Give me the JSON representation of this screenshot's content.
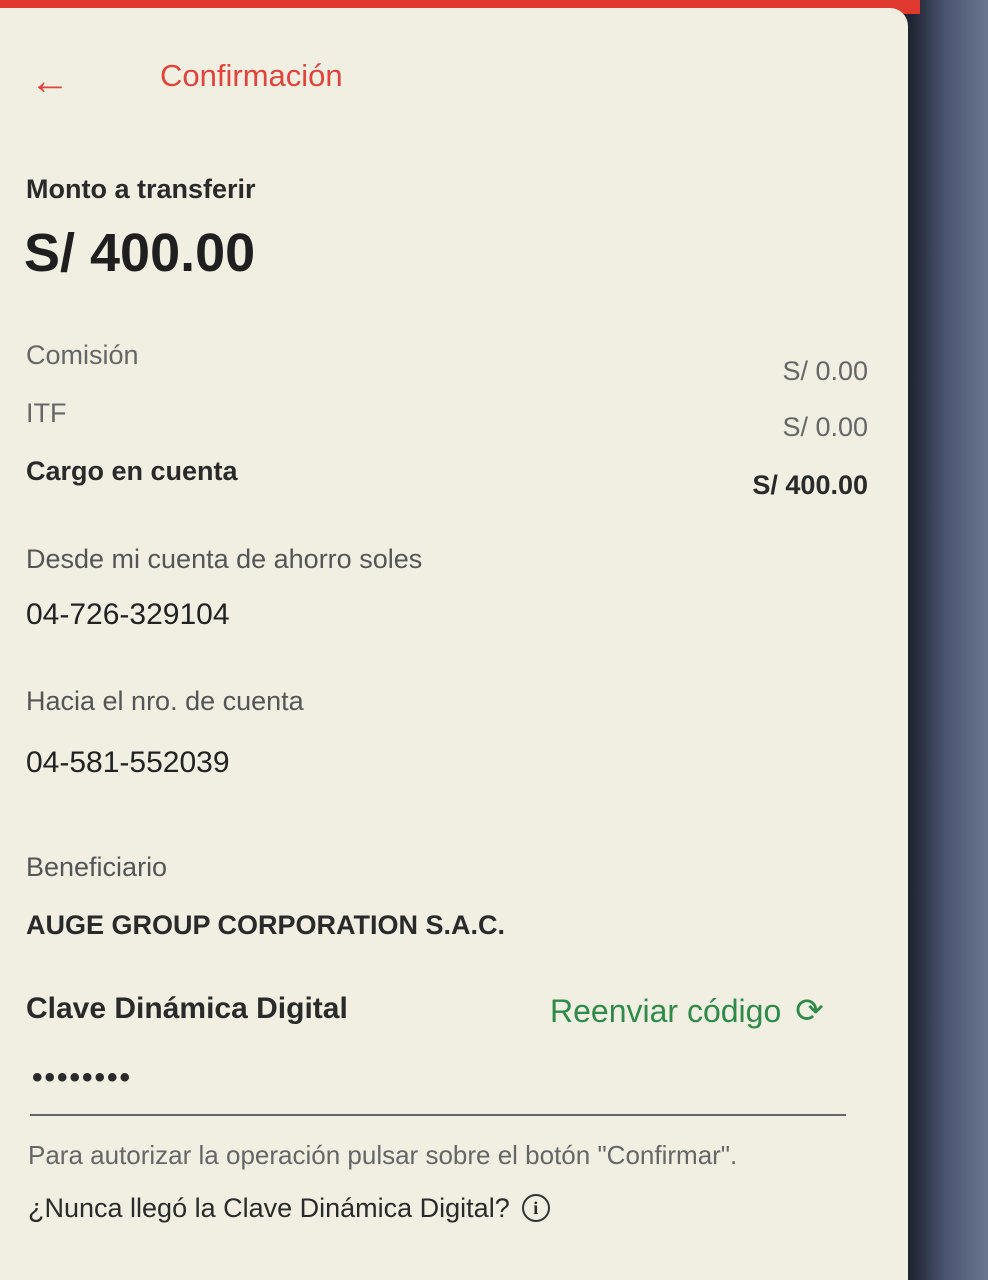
{
  "header": {
    "title": "Confirmación"
  },
  "transfer": {
    "label": "Monto a transferir",
    "amount": "S/ 400.00"
  },
  "charges": {
    "commission_label": "Comisión",
    "commission_value": "S/ 0.00",
    "itf_label": "ITF",
    "itf_value": "S/ 0.00",
    "total_label": "Cargo en cuenta",
    "total_value": "S/ 400.00"
  },
  "from": {
    "label": "Desde mi cuenta de ahorro soles",
    "account": "04-726-329104"
  },
  "to": {
    "label": "Hacia el nro. de cuenta",
    "account": "04-581-552039"
  },
  "beneficiary": {
    "label": "Beneficiario",
    "name": "AUGE GROUP CORPORATION S.A.C."
  },
  "dynamic_key": {
    "label": "Clave Dinámica Digital",
    "resend": "Reenviar código",
    "masked_value": "••••••••"
  },
  "help_text": "Para autorizar la operación pulsar sobre el botón \"Confirmar\".",
  "never_received": "¿Nunca llegó la Clave Dinámica Digital?",
  "colors": {
    "accent": "#e0443c",
    "link": "#2f8a4a"
  },
  "icons": {
    "back": "arrow-left-icon",
    "resend": "refresh-icon",
    "info": "info-icon"
  }
}
